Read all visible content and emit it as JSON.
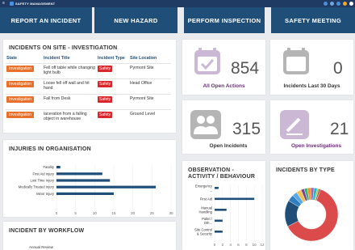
{
  "app": {
    "title": "SAFETY MANAGEMENT",
    "menu_glyph": "≡"
  },
  "topbar_icons": [
    {
      "name": "search-icon",
      "color": "#4a90e2"
    },
    {
      "name": "notification-icon",
      "color": "#6fa8dc"
    },
    {
      "name": "help-icon",
      "color": "#4a90e2"
    },
    {
      "name": "settings-icon",
      "color": "#f5a623"
    },
    {
      "name": "user-avatar-icon",
      "color": "#ffffff"
    }
  ],
  "tiles": {
    "report": "REPORT AN INCIDENT",
    "hazard": "NEW HAZARD",
    "inspection": "PERFORM INSPECTION",
    "meeting": "SAFETY MEETING"
  },
  "incidents": {
    "title": "INCIDENTS ON SITE - INVESTIGATION",
    "headers": [
      "State",
      "Incident Title",
      "Incident Type",
      "Site Location"
    ],
    "rows": [
      {
        "state": "Investigation",
        "title": "Fell off table while changing light bulb",
        "type": "Safety",
        "site": "Pyrmont Site"
      },
      {
        "state": "Investigation",
        "title": "Loose fell off wall and hit hand",
        "type": "Safety",
        "site": "Head Office"
      },
      {
        "state": "Investigation",
        "title": "Fall from Desk",
        "type": "Safety",
        "site": "Pyrmont Site"
      },
      {
        "state": "Investigation",
        "title": "laceration from a falling object in warehouse",
        "type": "Safety",
        "site": "Ground Level"
      }
    ]
  },
  "stats": {
    "open_actions": {
      "value": "854",
      "label": "All Open Actions",
      "color": "#6b2d7b"
    },
    "last30": {
      "value": "0",
      "label": "Incidents Last 30 Days",
      "color": "#333333"
    },
    "open_incidents": {
      "value": "315",
      "label": "Open Incidents",
      "color": "#333333"
    },
    "open_investigations": {
      "value": "21",
      "label": "Open Investigations",
      "color": "#6b2d7b"
    }
  },
  "injuries": {
    "title": "INJURIES IN ORGANISATION",
    "chart_data": {
      "type": "bar",
      "orientation": "horizontal",
      "categories": [
        "Fatality",
        "First Aid Injury",
        "Lost Time Injury",
        "Medically Treated Injury",
        "Minor Injury"
      ],
      "values": [
        1,
        12,
        14,
        26,
        15
      ],
      "xlim": [
        0,
        30
      ],
      "xticks": [
        "0",
        "5",
        "10",
        "15",
        "20",
        "25",
        "30"
      ],
      "color": "#1f4e79"
    }
  },
  "observation": {
    "title": "OBSERVATION - ACTIVITY / BEHAVIOUR",
    "chart_data": {
      "type": "bar",
      "orientation": "horizontal",
      "categories": [
        "Emergency ...",
        "First Aid",
        "Manual Handling",
        "Pallet / Oth...",
        "Site Control & Security"
      ],
      "values": [
        1,
        10,
        3,
        2,
        2
      ],
      "xlim": [
        0,
        12
      ],
      "xticks": [
        "0",
        "2",
        "4",
        "6",
        "8",
        "10",
        "12"
      ],
      "color": "#1f4e79"
    }
  },
  "incident_types": {
    "title": "INCIDENTS BY TYPE",
    "chart_data": {
      "type": "pie",
      "donut": true,
      "values": [
        62,
        16,
        4,
        3,
        3,
        2,
        2,
        2,
        2,
        2,
        1,
        1
      ],
      "colors": [
        "#dc4b4b",
        "#1f4e79",
        "#2f7fc1",
        "#5aa9e6",
        "#f2c14e",
        "#7a3f98",
        "#3cb371",
        "#f28e2b",
        "#9467bd",
        "#17becf",
        "#bcbd22",
        "#8c564b"
      ]
    }
  },
  "workflow": {
    "title": "INCIDENT BY WORKFLOW",
    "first_label": "Annual Review"
  }
}
